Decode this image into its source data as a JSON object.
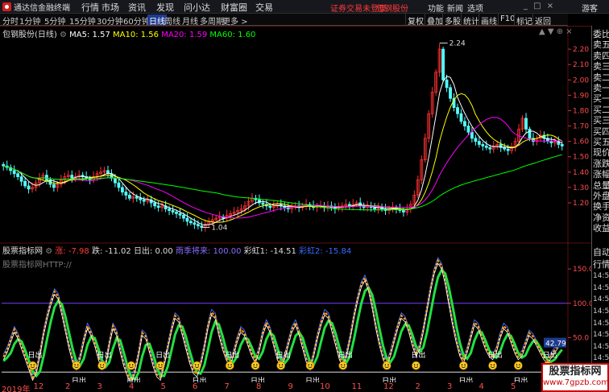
{
  "app": {
    "title": "通达信金融终端",
    "menus": [
      "行情",
      "市场",
      "资讯",
      "发现",
      "问小达",
      "财富圈",
      "交易"
    ],
    "login_status": "证券交易未登录",
    "stock_link": "包钢股份",
    "right_menus": [
      "功能",
      "新闻",
      "选项"
    ],
    "guest": "游客",
    "window_buttons": "_ □ ×"
  },
  "period_tabs": [
    "分时",
    "1分钟",
    "5分钟",
    "15分钟",
    "30分钟",
    "60分钟",
    "日线",
    "周线",
    "月线",
    "多周期",
    "更多 >"
  ],
  "active_tab": "日线",
  "toolbar": [
    "复权",
    "叠加",
    "多股",
    "统计",
    "画线",
    "F10",
    "标记",
    "返回"
  ],
  "main_header": {
    "name": "包钢股份(日线)",
    "ma5": "MA5: 1.57",
    "ma10": "MA10: 1.56",
    "ma20": "MA20: 1.59",
    "ma60": "MA60: 1.60"
  },
  "panel_controls": "▲ ▼ ⊕ ×",
  "price_labels": {
    "high": "2.24",
    "low": "1.04"
  },
  "sub_header": {
    "title": "股票指标网",
    "ind1": "涨: -7.98",
    "ind2": "跌: -11.02",
    "ind3": "日出: 0.00",
    "ind4": "雨季将来: 100.00",
    "ind5": "彩虹1: -14.51",
    "ind6": "彩虹2: -15.84"
  },
  "watermark": "股票指标网HTTP://",
  "sun_label": "日出",
  "indicator_value_tag": "42.79",
  "chart_data": [
    {
      "type": "candlestick",
      "title": "包钢股份(日线)",
      "y_ticks": [
        "2.20",
        "2.10",
        "2.00",
        "1.90",
        "1.80",
        "1.70",
        "1.60",
        "1.50",
        "1.40",
        "1.30",
        "1.20"
      ],
      "ylim": [
        0.98,
        2.3
      ],
      "ma_legend": [
        "MA5: 1.57",
        "MA10: 1.56",
        "MA20: 1.59",
        "MA60: 1.60"
      ],
      "closes": [
        1.44,
        1.43,
        1.41,
        1.39,
        1.37,
        1.34,
        1.31,
        1.29,
        1.3,
        1.33,
        1.36,
        1.38,
        1.35,
        1.32,
        1.3,
        1.32,
        1.35,
        1.37,
        1.38,
        1.36,
        1.37,
        1.38,
        1.37,
        1.36,
        1.35,
        1.37,
        1.39,
        1.4,
        1.41,
        1.39,
        1.36,
        1.33,
        1.3,
        1.27,
        1.25,
        1.23,
        1.24,
        1.23,
        1.22,
        1.21,
        1.22,
        1.2,
        1.18,
        1.17,
        1.18,
        1.16,
        1.15,
        1.14,
        1.13,
        1.12,
        1.1,
        1.08,
        1.07,
        1.06,
        1.05,
        1.04,
        1.06,
        1.08,
        1.09,
        1.1,
        1.11,
        1.1,
        1.12,
        1.13,
        1.14,
        1.15,
        1.16,
        1.18,
        1.21,
        1.23,
        1.22,
        1.2,
        1.19,
        1.18,
        1.17,
        1.18,
        1.19,
        1.18,
        1.17,
        1.16,
        1.17,
        1.18,
        1.17,
        1.18,
        1.19,
        1.18,
        1.17,
        1.18,
        1.18,
        1.17,
        1.18,
        1.17,
        1.16,
        1.17,
        1.18,
        1.19,
        1.18,
        1.19,
        1.2,
        1.18,
        1.17,
        1.18,
        1.17,
        1.16,
        1.17,
        1.16,
        1.15,
        1.16,
        1.17,
        1.16,
        1.15,
        1.14,
        1.16,
        1.19,
        1.25,
        1.35,
        1.48,
        1.62,
        1.78,
        1.92,
        2.05,
        2.2,
        2.0,
        1.95,
        1.88,
        1.82,
        1.78,
        1.73,
        1.7,
        1.66,
        1.62,
        1.6,
        1.58,
        1.57,
        1.56,
        1.55,
        1.57,
        1.58,
        1.56,
        1.55,
        1.54,
        1.56,
        1.6,
        1.68,
        1.75,
        1.68,
        1.62,
        1.6,
        1.62,
        1.64,
        1.62,
        1.6,
        1.59,
        1.6,
        1.58,
        1.57
      ],
      "labels": {
        "high": "2.24",
        "low": "1.04"
      }
    },
    {
      "type": "line",
      "title": "股票指标网",
      "y_ticks": [
        "150.0",
        "100.0",
        "50.0"
      ],
      "ylim": [
        -15,
        170
      ],
      "series": [
        {
          "name": "雨季将来",
          "values": [
            100,
            100,
            100,
            100,
            100,
            100,
            100,
            100,
            100,
            100,
            100,
            100,
            100,
            100,
            100,
            100,
            100,
            100,
            100,
            100,
            100,
            100,
            100,
            100,
            100,
            100,
            100,
            100,
            100,
            100,
            100,
            100,
            100,
            100,
            100,
            100,
            100,
            100,
            100,
            100,
            100,
            100,
            100,
            100,
            100,
            100,
            100,
            100,
            100,
            100,
            100,
            100,
            100,
            100,
            100,
            100,
            100,
            100,
            100,
            100,
            100,
            100,
            100,
            100,
            100,
            100,
            100,
            100,
            100,
            100,
            100,
            100,
            100,
            100,
            100,
            100,
            100,
            100,
            100,
            100,
            100,
            100,
            100,
            100,
            100,
            100,
            100,
            100,
            100,
            100,
            100,
            100,
            100,
            100,
            100,
            100,
            100,
            100,
            100,
            100,
            100,
            100,
            100,
            100,
            100,
            100,
            100,
            100,
            100,
            100,
            100,
            100,
            100,
            100,
            100,
            100,
            100,
            100,
            100,
            100,
            100,
            100,
            100,
            100,
            100,
            100,
            100,
            100,
            100,
            100,
            100,
            100,
            100,
            100,
            100,
            100,
            100,
            100,
            100,
            100,
            100,
            100,
            100,
            100,
            100,
            100,
            100,
            100,
            100,
            100,
            100,
            100,
            100,
            100,
            100,
            100,
            100,
            100,
            100,
            100
          ]
        },
        {
          "name": "日出",
          "values": [
            0,
            0,
            0,
            0,
            0,
            0,
            0,
            0,
            0,
            0,
            0,
            0,
            0,
            0,
            0,
            0,
            0,
            0,
            0,
            0,
            0,
            0,
            0,
            0,
            0,
            0,
            0,
            0,
            0,
            0,
            0,
            0,
            0,
            0,
            0,
            0,
            0,
            0,
            0,
            0,
            0,
            0,
            0,
            0,
            0,
            0,
            0,
            0,
            0,
            0,
            0,
            0,
            0,
            0,
            0,
            0,
            0,
            0,
            0,
            0,
            0,
            0,
            0,
            0,
            0,
            0,
            0,
            0,
            0,
            0,
            0,
            0,
            0,
            0,
            0,
            0,
            0,
            0,
            0,
            0,
            0,
            0,
            0,
            0,
            0,
            0,
            0,
            0,
            0,
            0,
            0,
            0,
            0,
            0,
            0,
            0,
            0,
            0,
            0,
            0,
            0,
            0,
            0,
            0,
            0,
            0,
            0,
            0,
            0,
            0,
            0,
            0,
            0,
            0,
            0,
            0,
            0,
            0,
            0,
            0,
            0,
            0,
            0,
            0,
            0,
            0,
            0,
            0,
            0,
            0,
            0,
            0,
            0,
            0,
            0,
            0,
            0,
            0,
            0,
            0,
            0,
            0,
            0,
            0,
            0,
            0,
            0,
            0,
            0,
            0,
            0,
            0,
            0,
            0,
            0,
            0,
            0,
            0,
            0,
            0
          ]
        },
        {
          "name": "彩虹1",
          "values": [
            20,
            30,
            45,
            60,
            50,
            35,
            20,
            5,
            -10,
            0,
            25,
            55,
            80,
            100,
            115,
            108,
            85,
            60,
            35,
            15,
            5,
            20,
            45,
            65,
            55,
            40,
            20,
            5,
            10,
            40,
            65,
            55,
            30,
            10,
            -5,
            -15,
            0,
            25,
            55,
            50,
            30,
            10,
            -5,
            -10,
            10,
            35,
            60,
            80,
            75,
            55,
            35,
            15,
            0,
            -5,
            10,
            35,
            65,
            85,
            80,
            55,
            35,
            20,
            10,
            25,
            45,
            60,
            55,
            40,
            25,
            15,
            30,
            55,
            70,
            60,
            40,
            20,
            10,
            20,
            40,
            60,
            70,
            55,
            35,
            15,
            5,
            25,
            50,
            70,
            85,
            80,
            60,
            40,
            20,
            10,
            25,
            50,
            80,
            105,
            125,
            135,
            120,
            95,
            65,
            40,
            20,
            10,
            25,
            45,
            65,
            80,
            75,
            60,
            40,
            25,
            35,
            60,
            90,
            120,
            145,
            160,
            152,
            130,
            100,
            70,
            45,
            25,
            15,
            30,
            50,
            70,
            65,
            50,
            35,
            25,
            20,
            30,
            50,
            65,
            60,
            45,
            30,
            20,
            25,
            40,
            55,
            50,
            40,
            30,
            20,
            15,
            22,
            30,
            38,
            42
          ]
        }
      ],
      "labels": {
        "tag": "42.79",
        "sun": "日出"
      }
    }
  ],
  "date_axis": [
    "2019年",
    "12",
    "2",
    "3",
    "4",
    "5",
    "6",
    "7",
    "8",
    "9",
    "10",
    "11",
    "12",
    "2",
    "3",
    "4",
    "5",
    "6"
  ],
  "right_panel": [
    "委比",
    "卖五",
    "卖四",
    "卖三",
    "卖二",
    "卖一",
    "买一",
    "买二",
    "买三",
    "买四",
    "买五",
    "现价",
    "涨跌",
    "涨幅",
    "总量",
    "外盘",
    "换手",
    "净资",
    "收益",
    "自动",
    "行情",
    "14:56",
    "14:56",
    "14:56",
    "14:56",
    "14:56",
    "14:56",
    "14:56",
    "14:56",
    "14:56",
    "14:56",
    "14:56"
  ],
  "bottom_logo": {
    "line1": "股票指标网",
    "line2": "www.7gpzb.com"
  },
  "colors": {
    "bg": "#000000",
    "up": "#ff3232",
    "down": "#54ffff",
    "ma5": "#ffffff",
    "ma10": "#ffff00",
    "ma20": "#ff00ff",
    "ma60": "#00ff00",
    "accent": "#1d3c8f",
    "purple_line": "#7a3cff"
  }
}
